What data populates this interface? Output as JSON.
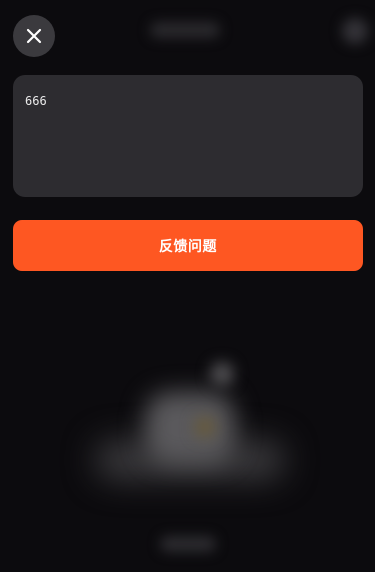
{
  "header": {
    "close_icon": "close-icon"
  },
  "feedback": {
    "input_value": "666"
  },
  "submit": {
    "label": "反馈问题"
  },
  "colors": {
    "background": "#0c0b0e",
    "accent": "#fe5722",
    "card": "#2d2c30",
    "close_button": "#3b3a3e"
  }
}
